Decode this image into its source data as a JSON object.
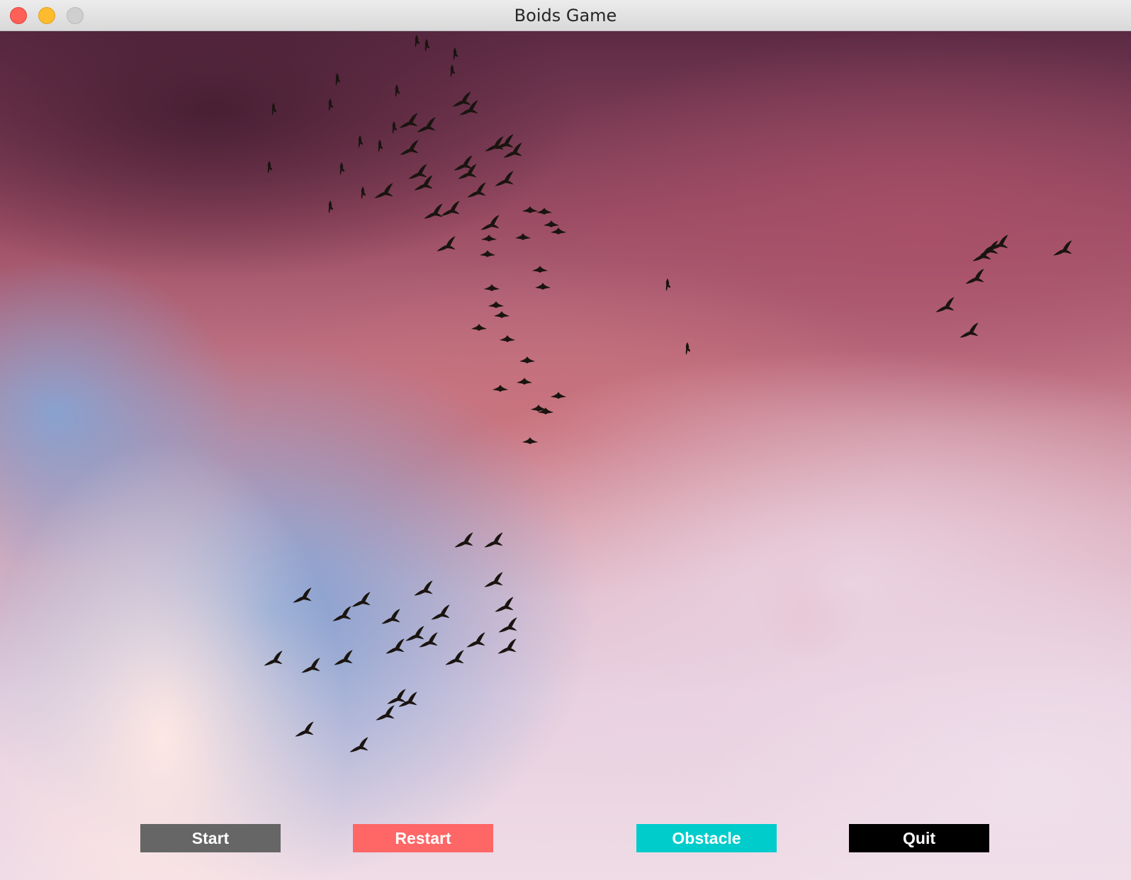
{
  "window": {
    "title": "Boids Game",
    "controls": [
      "close",
      "minimize",
      "maximize"
    ]
  },
  "canvas": {
    "background": "pink-sunset-cloud-sky",
    "bird_icon": "bird-icon",
    "bird_color": "#1a1410"
  },
  "buttons": {
    "start": {
      "label": "Start",
      "color": "#666666"
    },
    "restart": {
      "label": "Restart",
      "color": "#ff6666"
    },
    "obstacle": {
      "label": "Obstacle",
      "color": "#00cccc"
    },
    "quit": {
      "label": "Quit",
      "color": "#000000"
    }
  }
}
